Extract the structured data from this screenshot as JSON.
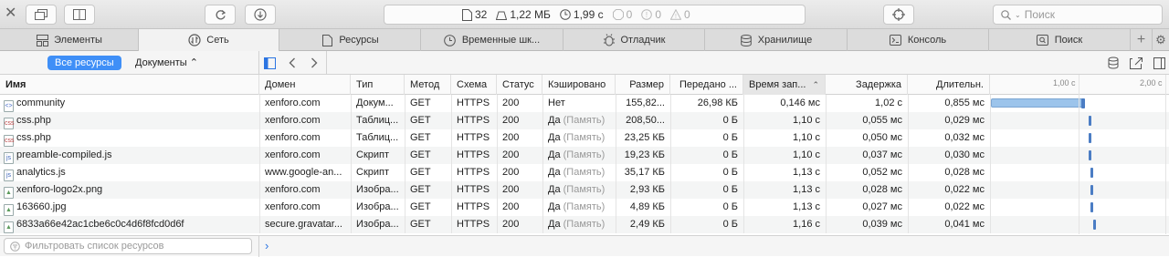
{
  "toolbar": {
    "stats": {
      "requests": "32",
      "size": "1,22 МБ",
      "time": "1,99 с",
      "errors": "0",
      "warnings": "0",
      "issues": "0"
    },
    "search_placeholder": "Поиск"
  },
  "tabs": [
    {
      "label": "Элементы",
      "icon": "elements-icon"
    },
    {
      "label": "Сеть",
      "icon": "network-icon"
    },
    {
      "label": "Ресурсы",
      "icon": "resources-icon"
    },
    {
      "label": "Временные шк...",
      "icon": "timeline-icon"
    },
    {
      "label": "Отладчик",
      "icon": "debugger-icon"
    },
    {
      "label": "Хранилище",
      "icon": "storage-icon"
    },
    {
      "label": "Консоль",
      "icon": "console-icon"
    },
    {
      "label": "Поиск",
      "icon": "search-tab-icon"
    }
  ],
  "filter": {
    "all_resources": "Все ресурсы",
    "documents": "Документы ⌃"
  },
  "columns": {
    "name": "Имя",
    "domain": "Домен",
    "type": "Тип",
    "method": "Метод",
    "scheme": "Схема",
    "status": "Статус",
    "cached": "Кэшировано",
    "size": "Размер",
    "transferred": "Передано ...",
    "time": "Время зап...",
    "latency": "Задержка",
    "duration": "Длительн."
  },
  "timeline_ticks": [
    "1,00 с",
    "2,00 с"
  ],
  "rows": [
    {
      "name": "community",
      "icon": "doc",
      "domain": "xenforo.com",
      "type": "Докум...",
      "method": "GET",
      "scheme": "HTTPS",
      "status": "200",
      "cached": "Нет",
      "cached_note": "",
      "size": "155,82...",
      "transferred": "26,98 КБ",
      "time": "0,146 мс",
      "latency": "1,02 с",
      "duration": "0,855 мс"
    },
    {
      "name": "css.php",
      "icon": "css",
      "domain": "xenforo.com",
      "type": "Таблиц...",
      "method": "GET",
      "scheme": "HTTPS",
      "status": "200",
      "cached": "Да",
      "cached_note": "(Память)",
      "size": "208,50...",
      "transferred": "0 Б",
      "time": "1,10 с",
      "latency": "0,055 мс",
      "duration": "0,029 мс"
    },
    {
      "name": "css.php",
      "icon": "css",
      "domain": "xenforo.com",
      "type": "Таблиц...",
      "method": "GET",
      "scheme": "HTTPS",
      "status": "200",
      "cached": "Да",
      "cached_note": "(Память)",
      "size": "23,25 КБ",
      "transferred": "0 Б",
      "time": "1,10 с",
      "latency": "0,050 мс",
      "duration": "0,032 мс"
    },
    {
      "name": "preamble-compiled.js",
      "icon": "js",
      "domain": "xenforo.com",
      "type": "Скрипт",
      "method": "GET",
      "scheme": "HTTPS",
      "status": "200",
      "cached": "Да",
      "cached_note": "(Память)",
      "size": "19,23 КБ",
      "transferred": "0 Б",
      "time": "1,10 с",
      "latency": "0,037 мс",
      "duration": "0,030 мс"
    },
    {
      "name": "analytics.js",
      "icon": "js",
      "domain": "www.google-an...",
      "type": "Скрипт",
      "method": "GET",
      "scheme": "HTTPS",
      "status": "200",
      "cached": "Да",
      "cached_note": "(Память)",
      "size": "35,17 КБ",
      "transferred": "0 Б",
      "time": "1,13 с",
      "latency": "0,052 мс",
      "duration": "0,028 мс"
    },
    {
      "name": "xenforo-logo2x.png",
      "icon": "img",
      "domain": "xenforo.com",
      "type": "Изобра...",
      "method": "GET",
      "scheme": "HTTPS",
      "status": "200",
      "cached": "Да",
      "cached_note": "(Память)",
      "size": "2,93 КБ",
      "transferred": "0 Б",
      "time": "1,13 с",
      "latency": "0,028 мс",
      "duration": "0,022 мс"
    },
    {
      "name": "163660.jpg",
      "icon": "img",
      "domain": "xenforo.com",
      "type": "Изобра...",
      "method": "GET",
      "scheme": "HTTPS",
      "status": "200",
      "cached": "Да",
      "cached_note": "(Память)",
      "size": "4,89 КБ",
      "transferred": "0 Б",
      "time": "1,13 с",
      "latency": "0,027 мс",
      "duration": "0,022 мс"
    },
    {
      "name": "6833a66e42ac1cbe6c0c4d6f8fcd0d6f",
      "icon": "img",
      "domain": "secure.gravatar...",
      "type": "Изобра...",
      "method": "GET",
      "scheme": "HTTPS",
      "status": "200",
      "cached": "Да",
      "cached_note": "(Память)",
      "size": "2,49 КБ",
      "transferred": "0 Б",
      "time": "1,16 с",
      "latency": "0,039 мс",
      "duration": "0,041 мс"
    }
  ],
  "filter_placeholder": "Фильтровать список ресурсов"
}
